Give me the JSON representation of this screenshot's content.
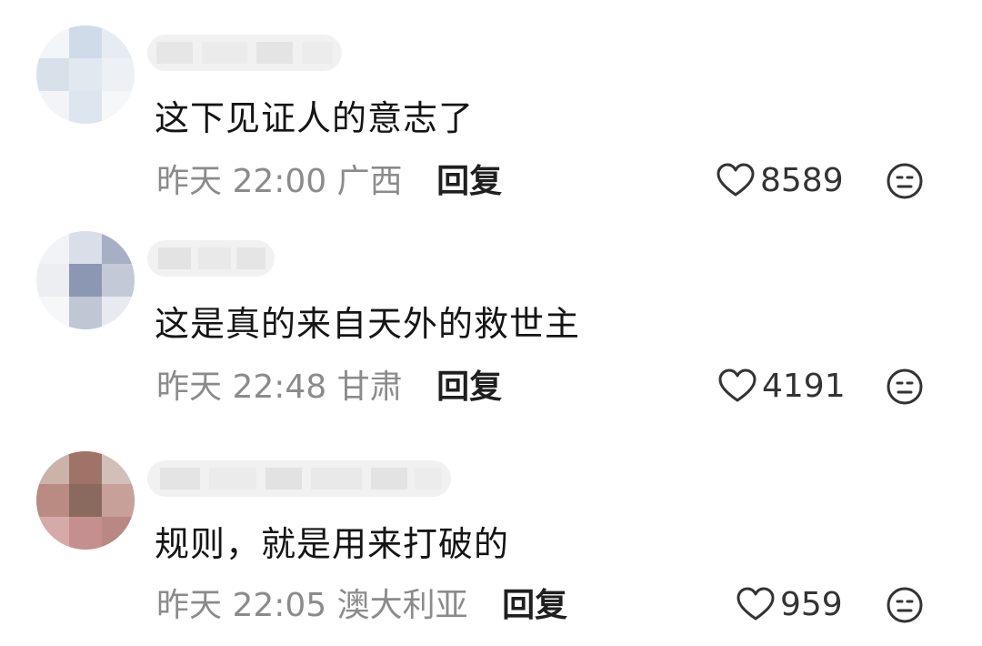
{
  "comments": [
    {
      "text": "这下见证人的意志了",
      "time": "昨天 22:00",
      "location": "广西",
      "reply_label": "回复",
      "likes": "8589",
      "avatar_colors": [
        "#dde6ef",
        "#e9eef4",
        "#d3dce6",
        "#eef2f6"
      ]
    },
    {
      "text": "这是真的来自天外的救世主",
      "time": "昨天 22:48",
      "location": "甘肃",
      "reply_label": "回复",
      "likes": "4191",
      "avatar_colors": [
        "#9aa4bd",
        "#c7cdd9",
        "#b4bccb",
        "#e3e6ec"
      ]
    },
    {
      "text": "规则，就是用来打破的",
      "time": "昨天 22:05",
      "location": "澳大利亚",
      "reply_label": "回复",
      "likes": "959",
      "avatar_colors": [
        "#a06d66",
        "#c08d86",
        "#8f7a6e",
        "#d3a9a6"
      ]
    }
  ],
  "colors": {
    "text": "#151515",
    "meta": "#8b8b8b",
    "reply": "#1f1f1f",
    "icon": "#333333",
    "background": "#ffffff"
  },
  "icons": {
    "like": "heart-outline-icon",
    "dislike": "meh-face-icon"
  }
}
